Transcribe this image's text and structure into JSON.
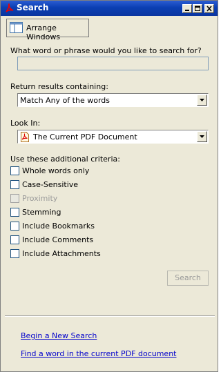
{
  "window": {
    "title": "Search"
  },
  "toolbar": {
    "arrange_label": "Arrange Windows"
  },
  "query": {
    "prompt": "What word or phrase would you like to search for?",
    "value": ""
  },
  "results": {
    "label": "Return results containing:",
    "selected": "Match Any of the words"
  },
  "look_in": {
    "label": "Look In:",
    "selected": "The Current PDF Document"
  },
  "criteria": {
    "label": "Use these additional criteria:",
    "options": [
      {
        "label": "Whole words only",
        "checked": false,
        "enabled": true
      },
      {
        "label": "Case-Sensitive",
        "checked": false,
        "enabled": true
      },
      {
        "label": "Proximity",
        "checked": false,
        "enabled": false
      },
      {
        "label": "Stemming",
        "checked": false,
        "enabled": true
      },
      {
        "label": "Include Bookmarks",
        "checked": false,
        "enabled": true
      },
      {
        "label": "Include Comments",
        "checked": false,
        "enabled": true
      },
      {
        "label": "Include Attachments",
        "checked": false,
        "enabled": true
      }
    ]
  },
  "search_button": {
    "label": "Search",
    "enabled": false
  },
  "links": {
    "new_search": "Begin a New Search",
    "find_word": "Find a word in the current PDF document"
  },
  "colors": {
    "titlebar": "#0b3fb3",
    "link": "#0000cc",
    "face": "#ece9d8"
  },
  "icons": [
    "acrobat-icon",
    "minimize-icon",
    "maximize-icon",
    "close-icon",
    "arrange-windows-icon",
    "pdf-document-icon",
    "dropdown-arrow-icon"
  ]
}
